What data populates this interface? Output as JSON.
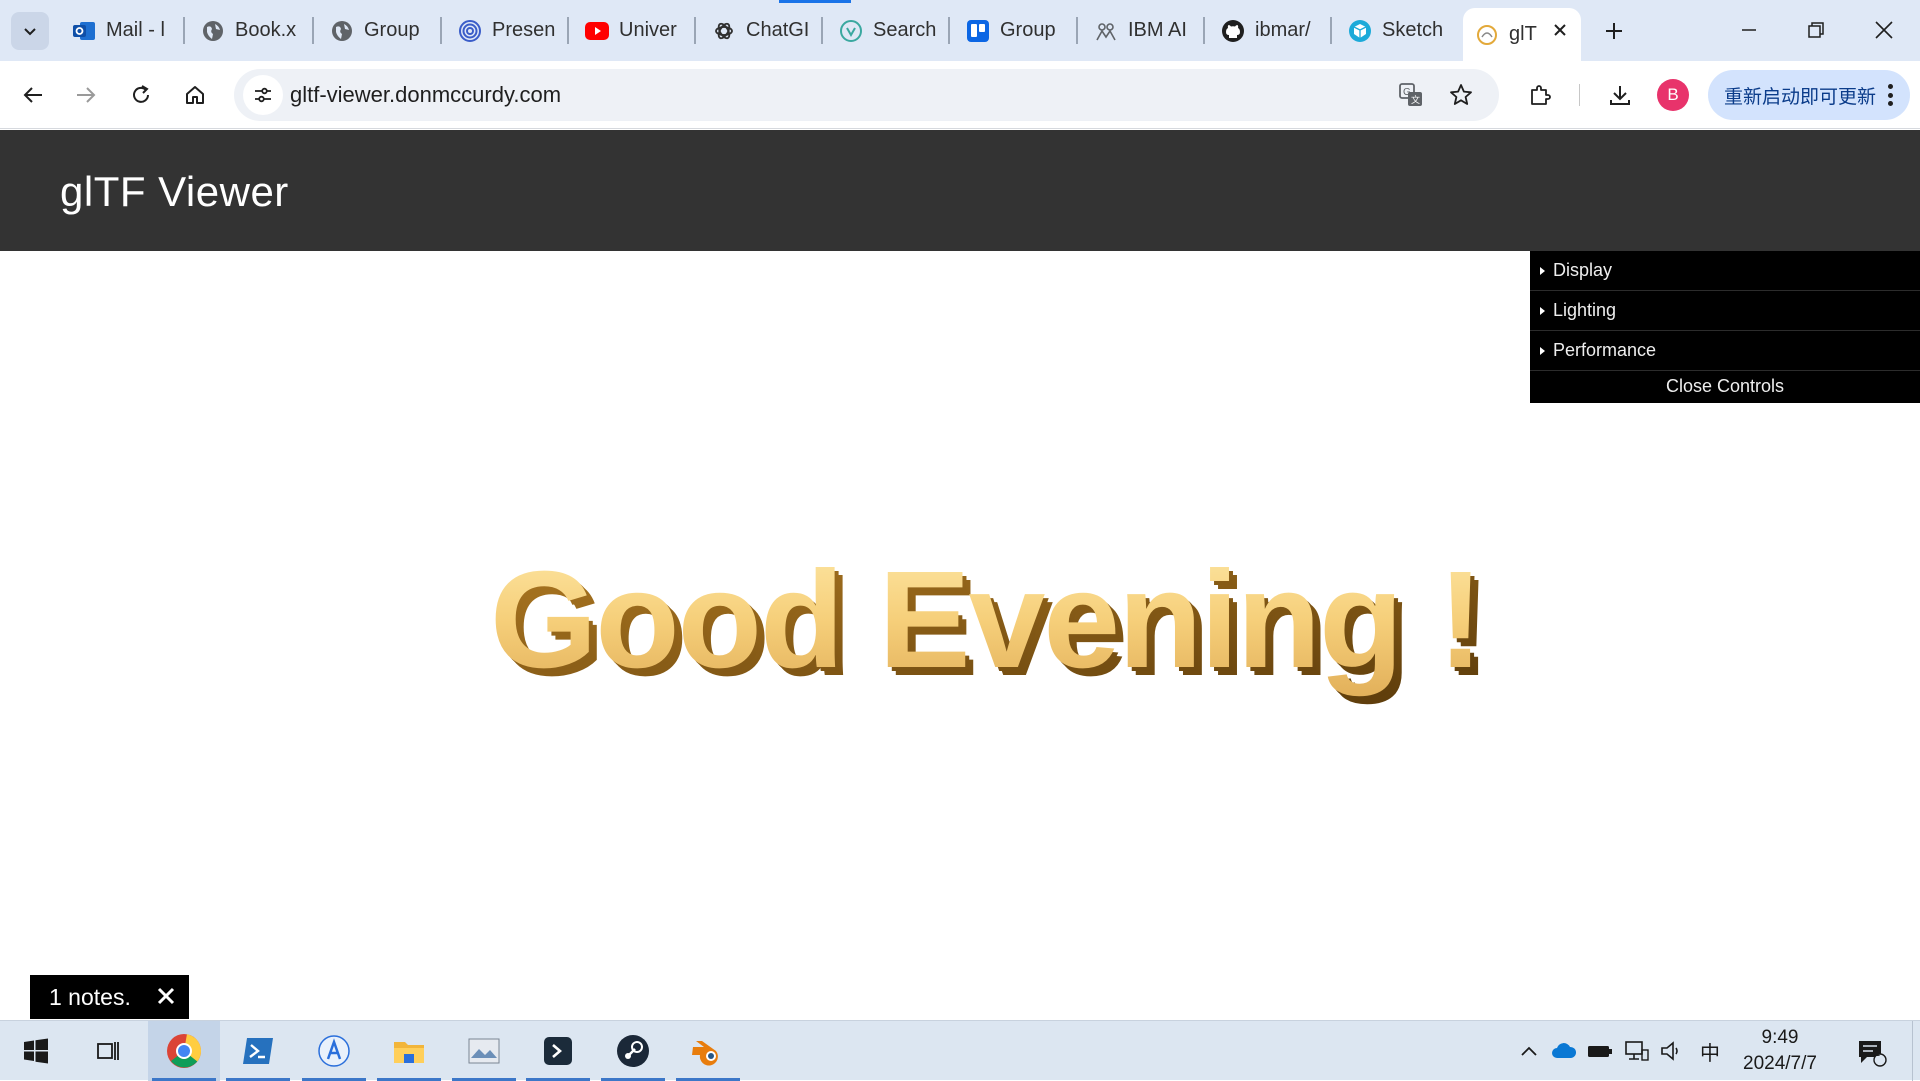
{
  "browser": {
    "tabs": [
      {
        "title": "Mail - l",
        "icon": "outlook-icon"
      },
      {
        "title": "Book.x",
        "icon": "globe-icon"
      },
      {
        "title": "Group",
        "icon": "globe-icon"
      },
      {
        "title": "Presen",
        "icon": "spiral-icon"
      },
      {
        "title": "Univer",
        "icon": "youtube-icon"
      },
      {
        "title": "ChatGI",
        "icon": "chatgpt-icon"
      },
      {
        "title": "Search",
        "icon": "search-brand-icon"
      },
      {
        "title": "Group",
        "icon": "trello-icon"
      },
      {
        "title": "IBM AI",
        "icon": "ibm-icon"
      },
      {
        "title": "ibmar/",
        "icon": "github-icon"
      },
      {
        "title": "Sketch",
        "icon": "sketchfab-icon"
      }
    ],
    "active_tab": {
      "title": "glT",
      "icon": "gltf-icon"
    },
    "url": "gltf-viewer.donmccurdy.com",
    "profile_initial": "B",
    "update_label": "重新启动即可更新"
  },
  "page": {
    "title": "glTF Viewer",
    "model_text": "Good Evening !",
    "gui": {
      "folders": [
        "Display",
        "Lighting",
        "Performance"
      ],
      "close_label": "Close Controls"
    },
    "toast": "1 notes."
  },
  "taskbar": {
    "apps": [
      "start-icon",
      "task-view-icon",
      "chrome-icon",
      "powershell-icon",
      "app-store-icon",
      "file-explorer-icon",
      "image-viewer-icon",
      "terminal-icon",
      "steam-icon",
      "blender-icon"
    ],
    "ime": "中",
    "time": "9:49",
    "date": "2024/7/7",
    "notification_count": "1"
  },
  "colors": {
    "header_bg": "#333333",
    "tab_strip_bg": "#dfe8f6",
    "gold_text": "#e9b957",
    "profile_badge": "#e8336b",
    "update_button": "#d3e3fd"
  }
}
